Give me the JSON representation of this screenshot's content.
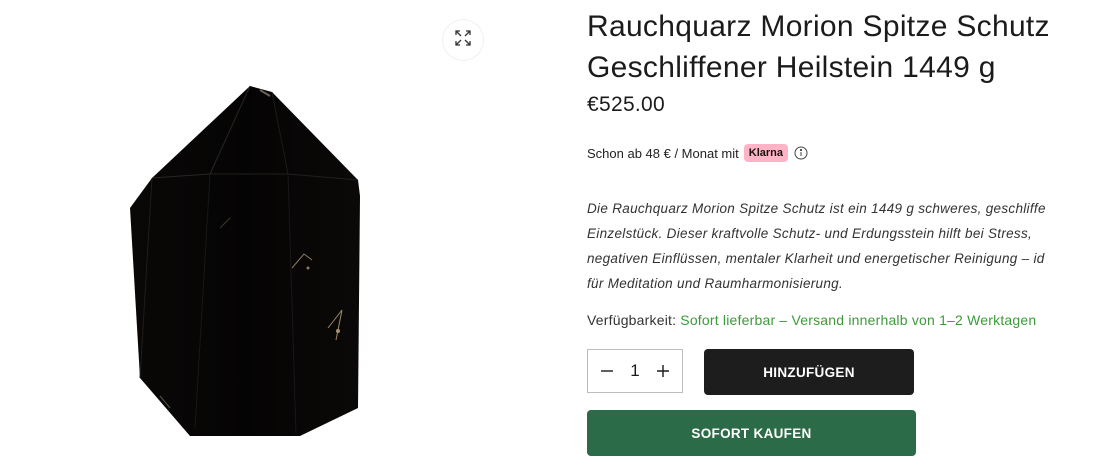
{
  "gallery": {
    "zoom_icon": "expand-arrows-icon",
    "image_alt": "Rauchquarz Morion Spitze"
  },
  "product": {
    "title_line1": "Rauchquarz Morion Spitze Schutz",
    "title_line2": "Geschliffener Heilstein 1449 g",
    "price": "€525.00"
  },
  "klarna": {
    "text": "Schon ab 48 € / Monat mit",
    "badge": "Klarna",
    "info_icon": "info-circle-icon",
    "badge_color": "#ffb3c7"
  },
  "description": {
    "lines": [
      "Die Rauchquarz Morion Spitze Schutz ist ein 1449 g schweres, geschliffe",
      "Einzelstück. Dieser kraftvolle Schutz- und Erdungsstein hilft bei Stress,",
      "negativen Einflüssen, mentaler Klarheit und energetischer Reinigung – id",
      "für Meditation und Raumharmonisierung."
    ]
  },
  "availability": {
    "label": "Verfügbarkeit:",
    "value": "Sofort lieferbar – Versand innerhalb von 1–2 Werktagen",
    "value_color": "#3d9a3a"
  },
  "quantity": {
    "value": "1",
    "minus_icon": "minus-icon",
    "plus_icon": "plus-icon"
  },
  "actions": {
    "add_to_cart": "HINZUFÜGEN",
    "buy_now": "SOFORT KAUFEN",
    "add_color": "#1d1d1d",
    "buy_color": "#2c6b47"
  }
}
